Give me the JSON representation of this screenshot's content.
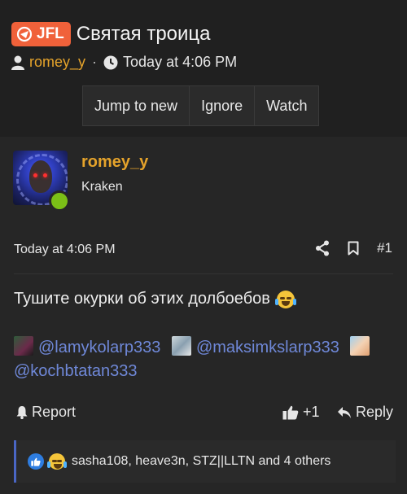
{
  "thread": {
    "prefix": "JFL",
    "title": "Святая троица",
    "author": "romey_y",
    "separator": "·",
    "time": "Today at 4:06 PM"
  },
  "thread_actions": {
    "jump_to_new": "Jump to new",
    "ignore": "Ignore",
    "watch": "Watch"
  },
  "post": {
    "author_name": "romey_y",
    "author_title": "Kraken",
    "time": "Today at 4:06 PM",
    "number": "#1",
    "text": "Тушите окурки об этих долбоебов",
    "mentions": [
      "@lamykolarp333",
      "@maksimkslarp333",
      "@kochbtatan333"
    ],
    "report_label": "Report",
    "like_count": "+1",
    "reply_label": "Reply",
    "reactions_text": "sasha108, heave3n, STZ||LLTN and 4 others"
  },
  "colors": {
    "accent_orange": "#f0613a",
    "username": "#e5a32b",
    "mention_link": "#6f88d8",
    "online": "#7bbf17"
  },
  "icons": [
    "user-icon",
    "clock-icon",
    "share-icon",
    "bookmark-icon",
    "bell-icon",
    "thumbs-up-icon",
    "reply-icon",
    "laughing-emoji-icon"
  ]
}
